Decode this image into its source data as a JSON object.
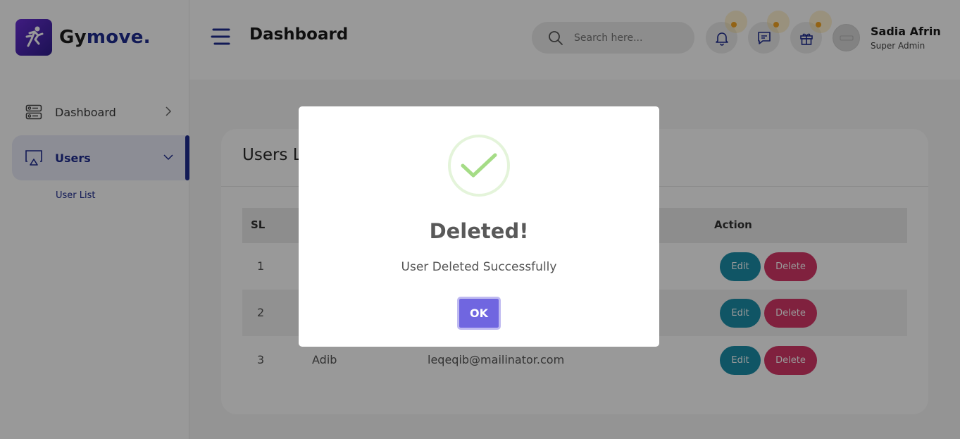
{
  "brand": {
    "prefix": "Gy",
    "suffix": "move.",
    "accent_color": "#1f2c8f",
    "logo_color": "#5b2bc7"
  },
  "sidebar": {
    "items": [
      {
        "label": "Dashboard",
        "icon": "dashboard-icon",
        "expanded": false
      },
      {
        "label": "Users",
        "icon": "users-icon",
        "expanded": true,
        "active": true
      }
    ],
    "sub_items": [
      {
        "label": "User List"
      }
    ]
  },
  "header": {
    "title": "Dashboard",
    "search_placeholder": "Search here...",
    "icons": [
      "bell-icon",
      "chat-icon",
      "gift-icon"
    ],
    "user": {
      "name": "Sadia Afrin",
      "role": "Super Admin"
    }
  },
  "main": {
    "card_title": "Users List",
    "columns": [
      "SL",
      "Action"
    ],
    "rows": [
      {
        "sl": "1",
        "name": "",
        "email": ""
      },
      {
        "sl": "2",
        "name": "",
        "email": ""
      },
      {
        "sl": "3",
        "name": "Adib",
        "email": "leqeqib@mailinator.com"
      }
    ],
    "edit_label": "Edit",
    "delete_label": "Delete",
    "edit_color": "#1c8ea8",
    "delete_color": "#d63868"
  },
  "modal": {
    "icon": "success-check-icon",
    "title": "Deleted!",
    "message": "User Deleted Successfully",
    "ok_label": "OK",
    "ok_color": "#7066e0",
    "check_color": "#a5dc86"
  }
}
